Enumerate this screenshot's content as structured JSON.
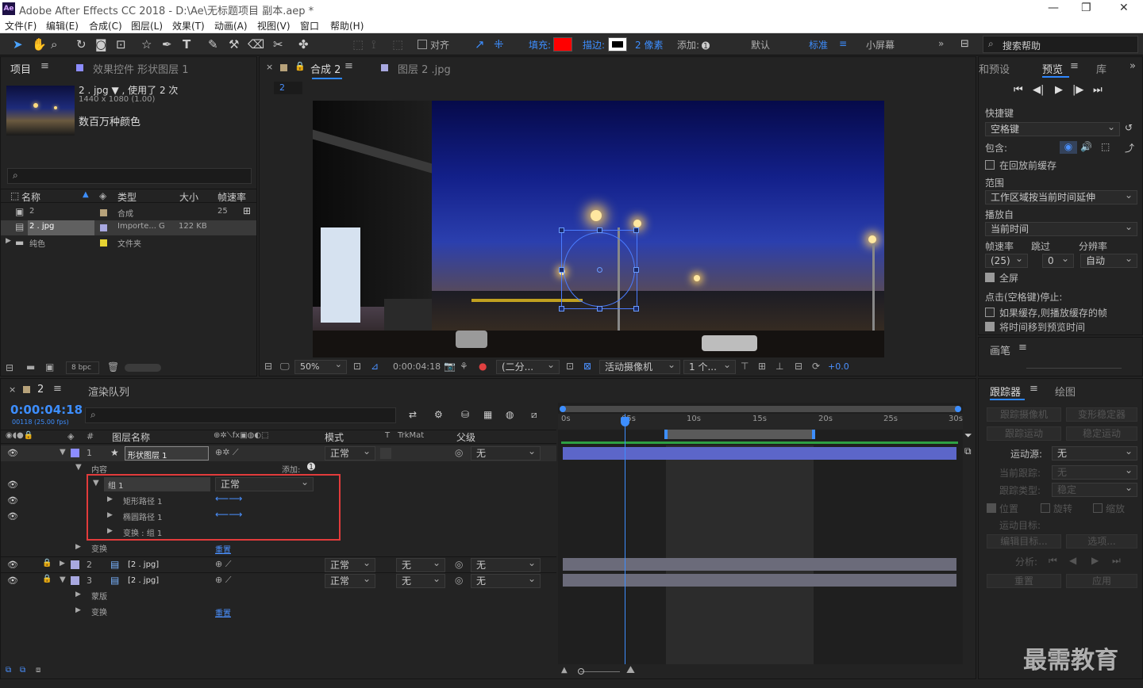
{
  "app": {
    "title": "Adobe After Effects CC 2018 - D:\\Ae\\无标题项目 副本.aep *",
    "logo": "Ae"
  },
  "menu": [
    "文件(F)",
    "编辑(E)",
    "合成(C)",
    "图层(L)",
    "效果(T)",
    "动画(A)",
    "视图(V)",
    "窗口",
    "帮助(H)"
  ],
  "toolbar": {
    "align": "对齐",
    "fill": "填充:",
    "stroke": "描边:",
    "stroke_px": "2 像素",
    "add": "添加:",
    "workspaces": [
      "默认",
      "标准",
      "小屏幕"
    ],
    "search": "搜索帮助",
    "fill_color": "#ff0000"
  },
  "project": {
    "tab": "项目",
    "tab2": "效果控件 形状图层 1",
    "file_name": "2 . jpg ▼ , 使用了 2 次",
    "file_dims": "1440 x 1080 (1.00)",
    "file_color": "数百万种颜色",
    "cols": [
      "名称",
      "类型",
      "大小",
      "帧速率"
    ],
    "rows": [
      {
        "name": "2",
        "type": "合成",
        "size": "",
        "fps": "25"
      },
      {
        "name": "2 . jpg",
        "type": "Importe... G",
        "size": "122 KB",
        "fps": ""
      },
      {
        "name": "纯色",
        "type": "文件夹",
        "size": "",
        "fps": ""
      }
    ],
    "bpc": "8 bpc"
  },
  "comp": {
    "tab1": "合成 2",
    "tab2": "图层 2 .jpg",
    "sub": "2",
    "zoom": "50%",
    "time": "0:00:04:18",
    "res": "(二分...",
    "camera": "活动摄像机",
    "views": "1 个...",
    "exposure": "+0.0"
  },
  "preview": {
    "tabs": [
      "和预设",
      "预览",
      "库"
    ],
    "shortcut_label": "快捷键",
    "shortcut": "空格键",
    "include": "包含:",
    "cache_before": "在回放前缓存",
    "range_label": "范围",
    "range": "工作区域按当前时间延伸",
    "play_from_label": "播放自",
    "play_from": "当前时间",
    "fps_label": "帧速率",
    "skip_label": "跳过",
    "res_label": "分辨率",
    "fps": "(25)",
    "skip": "0",
    "res": "自动",
    "fullscreen": "全屏",
    "stop_label": "点击(空格键)停止:",
    "cache_opt": "如果缓存,则播放缓存的帧",
    "move_time": "将时间移到预览时间",
    "brush_tab": "画笔"
  },
  "timeline": {
    "tab": "2",
    "render_tab": "渲染队列",
    "time": "0:00:04:18",
    "fps_info": "00118 (25.00 fps)",
    "cols": {
      "name": "图层名称",
      "mode": "模式",
      "t": "T",
      "trkmat": "TrkMat",
      "parent": "父级"
    },
    "ruler": [
      "0s",
      "05s",
      "10s",
      "15s",
      "20s",
      "25s",
      "30s"
    ],
    "layers": [
      {
        "num": "1",
        "name": "形状图层 1",
        "mode": "正常",
        "parent": "无"
      },
      {
        "num": "2",
        "name": "[2 . jpg]",
        "mode": "正常",
        "trk": "无",
        "parent": "无"
      },
      {
        "num": "3",
        "name": "[2 . jpg]",
        "mode": "正常",
        "trk": "无",
        "parent": "无"
      }
    ],
    "content": "内容",
    "add": "添加:",
    "group": "组 1",
    "group_mode": "正常",
    "rect": "矩形路径 1",
    "ellipse": "椭圆路径 1",
    "transform_group": "变换 : 组 1",
    "transform": "变换",
    "reset": "重置",
    "mask": "蒙版"
  },
  "tracker": {
    "tabs": [
      "跟踪器",
      "绘图"
    ],
    "btns": [
      "跟踪摄像机",
      "变形稳定器",
      "跟踪运动",
      "稳定运动"
    ],
    "motion_source_label": "运动源:",
    "motion_source": "无",
    "current_track": "当前跟踪:",
    "track_type": "跟踪类型:",
    "track_type_val": "稳定",
    "position": "位置",
    "rotation": "旋转",
    "scale": "缩放",
    "motion_target": "运动目标:",
    "edit_target": "编辑目标...",
    "options": "选项...",
    "analyze": "分析:",
    "reset": "重置",
    "apply": "应用"
  },
  "watermark": "最需教育"
}
